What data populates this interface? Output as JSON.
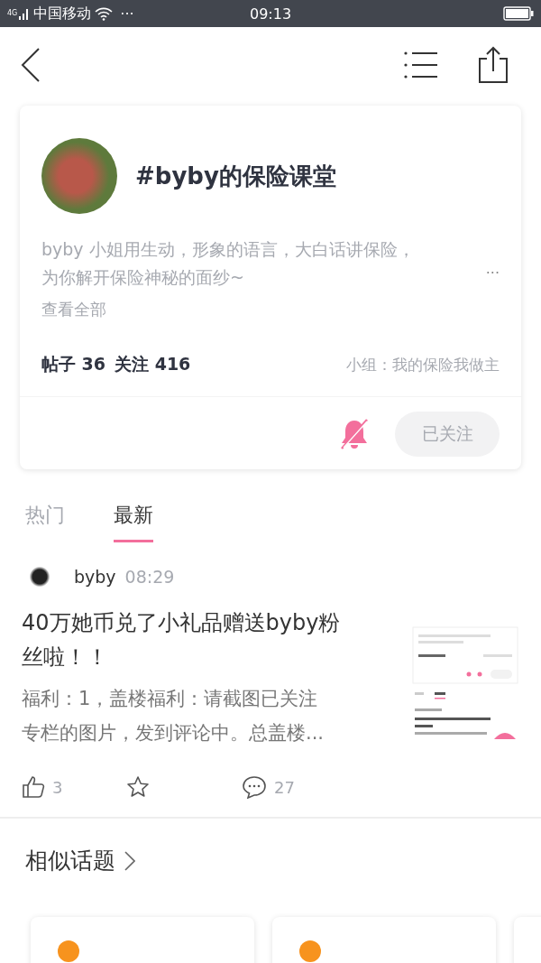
{
  "status_bar": {
    "network": "4G",
    "carrier": "中国移动",
    "more": "···",
    "time": "09:13"
  },
  "topic": {
    "title": "#byby的保险课堂",
    "description_lines": [
      "byby 小姐用生动，形象的语言，大白话讲保险，",
      "为你解开保险神秘的面纱~"
    ],
    "more": "···",
    "view_all": "查看全部",
    "posts": "帖子 36",
    "followers": "关注 416",
    "group": "小组：我的保险我做主",
    "muted": true,
    "followed": true,
    "follow_button": "已关注"
  },
  "tabs": [
    {
      "label": "热门",
      "selected": false
    },
    {
      "label": "最新",
      "selected": true
    }
  ],
  "post": {
    "author": "byby",
    "time": "08:29",
    "title_lines": [
      "40万她币兑了小礼品赠送byby粉",
      "丝啦！！"
    ],
    "excerpt_lines": [
      "福利：1，盖楼福利：请截图已关注",
      "专栏的图片，发到评论中。总盖楼..."
    ],
    "likes": "3",
    "comments": "27"
  },
  "similar": {
    "title": "相似话题"
  }
}
